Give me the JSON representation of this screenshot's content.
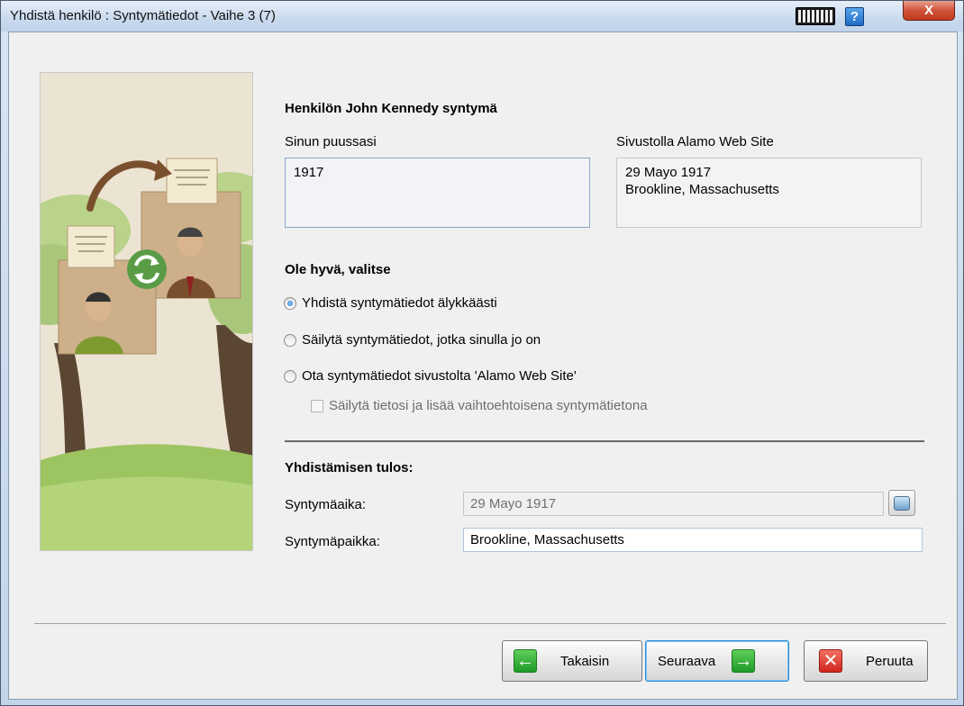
{
  "window": {
    "title": "Yhdistä henkilö : Syntymätiedot - Vaihe 3 (7)",
    "help_label": "?",
    "close_label": "X"
  },
  "section": {
    "heading": "Henkilön John Kennedy syntymä",
    "tree_label": "Sinun puussasi",
    "tree_value": "1917",
    "site_label": "Sivustolla Alamo Web Site",
    "site_value": "29 Mayo 1917\nBrookline, Massachusetts"
  },
  "choose": {
    "heading": "Ole hyvä, valitse",
    "options": [
      {
        "label": "Yhdistä syntymätiedot älykkäästi",
        "selected": true
      },
      {
        "label": "Säilytä syntymätiedot, jotka sinulla jo on",
        "selected": false
      },
      {
        "label": "Ota syntymätiedot sivustolta 'Alamo Web Site'",
        "selected": false
      }
    ],
    "checkbox_label": "Säilytä tietosi ja lisää vaihtoehtoisena syntymätietona",
    "checkbox_checked": false
  },
  "result": {
    "heading": "Yhdistämisen tulos:",
    "date_label": "Syntymäaika:",
    "date_value": "29 Mayo 1917",
    "place_label": "Syntymäpaikka:",
    "place_value": "Brookline, Massachusetts"
  },
  "buttons": {
    "back": "Takaisin",
    "next": "Seuraava",
    "cancel": "Peruuta"
  },
  "icons": {
    "back": "arrow-left-icon",
    "next": "arrow-right-icon",
    "cancel": "x-icon",
    "calendar": "calendar-icon",
    "keyboard": "keyboard-icon",
    "help": "help-icon"
  }
}
